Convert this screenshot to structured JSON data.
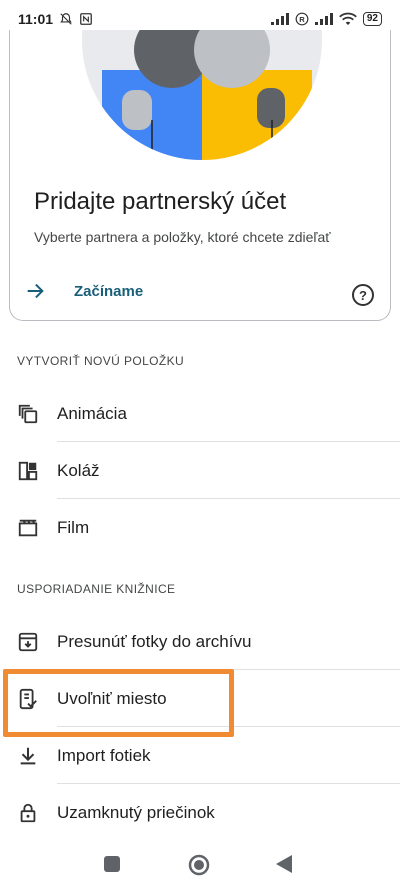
{
  "status_bar": {
    "time": "11:01",
    "battery": "92",
    "icons": [
      "mute-icon",
      "nfc-icon",
      "signal-icon",
      "roaming-icon",
      "signal-icon-2",
      "wifi-icon",
      "battery-icon"
    ]
  },
  "card": {
    "title": "Pridajte partnerský účet",
    "subtitle": "Vyberte partnera a položky, ktoré chcete zdieľať",
    "action_label": "Začíname",
    "help_icon": "?",
    "colors": {
      "blue": "#4285f4",
      "yellow": "#fbbc04",
      "gray": "#5f6368",
      "light_gray": "#bdc1c6"
    }
  },
  "create_section": {
    "header": "VYTVORIŤ NOVÚ POLOŽKU",
    "items": [
      {
        "label": "Animácia",
        "icon": "animation-icon"
      },
      {
        "label": "Koláž",
        "icon": "collage-icon"
      },
      {
        "label": "Film",
        "icon": "movie-icon"
      }
    ]
  },
  "library_section": {
    "header": "USPORIADANIE KNIŽNICE",
    "items": [
      {
        "label": "Presunúť fotky do archívu",
        "icon": "archive-icon"
      },
      {
        "label": "Uvoľniť miesto",
        "icon": "free-space-icon"
      },
      {
        "label": "Import fotiek",
        "icon": "download-icon"
      },
      {
        "label": "Uzamknutý priečinok",
        "icon": "lock-icon"
      }
    ]
  },
  "highlight_color": "#f08a33",
  "navbar": {
    "icons": [
      "recents-icon",
      "home-icon",
      "back-icon"
    ]
  }
}
